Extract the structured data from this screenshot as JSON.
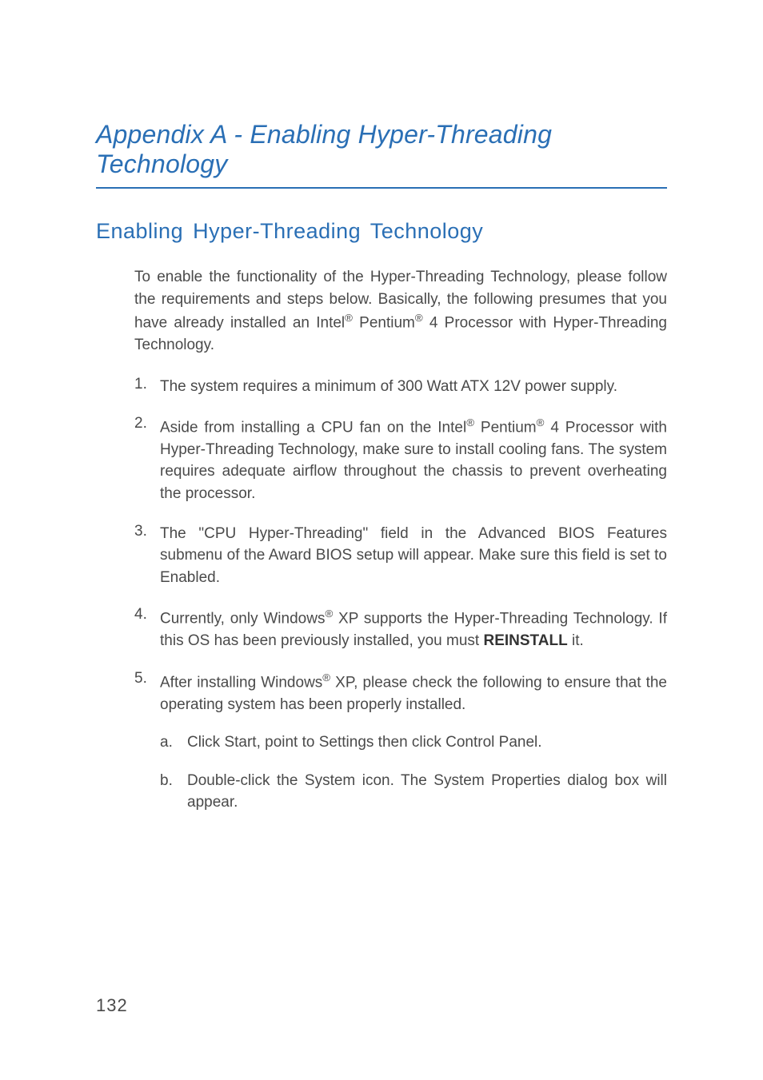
{
  "appendixTitle": "Appendix A - Enabling Hyper-Threading Technology",
  "sectionTitle": "Enabling Hyper-Threading Technology",
  "intro": {
    "part1": "To enable the functionality of the Hyper-Threading Technology, please follow the requirements and steps below. Basically, the following presumes that you have already installed an Intel",
    "reg1": "®",
    "part2": " Pentium",
    "reg2": "®",
    "part3": " 4 Processor with Hyper-Threading Technology."
  },
  "items": [
    {
      "num": "1.",
      "parts": [
        {
          "t": "text",
          "v": "The system requires a minimum of 300 Watt ATX 12V power supply."
        }
      ]
    },
    {
      "num": "2.",
      "parts": [
        {
          "t": "text",
          "v": "Aside from installing a CPU fan on the Intel"
        },
        {
          "t": "sup",
          "v": "®"
        },
        {
          "t": "text",
          "v": " Pentium"
        },
        {
          "t": "sup",
          "v": "®"
        },
        {
          "t": "text",
          "v": " 4 Processor with Hyper-Threading Technology, make sure to install cooling fans. The system requires adequate airflow throughout the chassis to prevent overheating the processor."
        }
      ]
    },
    {
      "num": "3.",
      "parts": [
        {
          "t": "text",
          "v": "The \"CPU Hyper-Threading\" field in the Advanced BIOS Features submenu of the Award BIOS setup will appear. Make sure this field is set to Enabled."
        }
      ]
    },
    {
      "num": "4.",
      "parts": [
        {
          "t": "text",
          "v": "Currently, only Windows"
        },
        {
          "t": "sup",
          "v": "®"
        },
        {
          "t": "text",
          "v": " XP supports the Hyper-Threading Technology. If this OS has been previously installed, you must "
        },
        {
          "t": "bold",
          "v": "REINSTALL"
        },
        {
          "t": "text",
          "v": " it."
        }
      ]
    },
    {
      "num": "5.",
      "parts": [
        {
          "t": "text",
          "v": "After installing Windows"
        },
        {
          "t": "sup",
          "v": "®"
        },
        {
          "t": "text",
          "v": " XP, please check the following to ensure that the operating system has been properly installed."
        }
      ],
      "sub": [
        {
          "letter": "a.",
          "text": "Click Start, point to Settings then click Control Panel."
        },
        {
          "letter": "b.",
          "text": "Double-click the System icon. The System Properties dialog box will appear."
        }
      ]
    }
  ],
  "pageNumber": "132"
}
